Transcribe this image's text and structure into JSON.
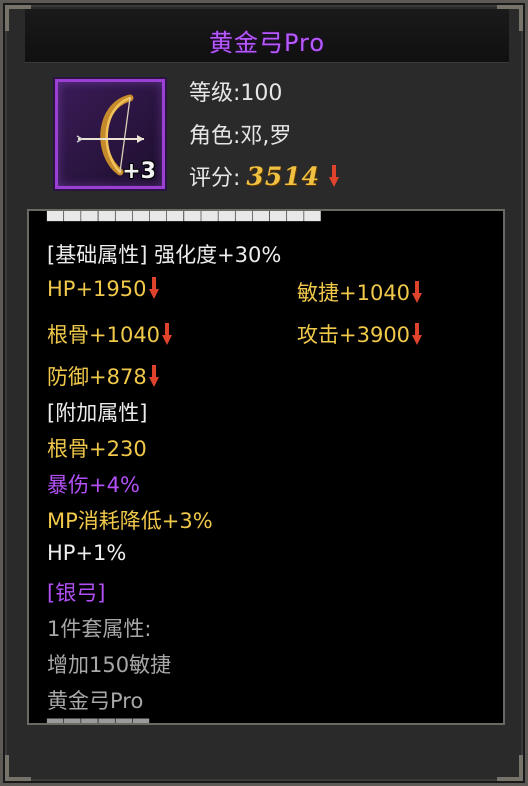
{
  "item": {
    "name": "黄金弓Pro",
    "enhance_label": "+3",
    "icon": "bow-icon"
  },
  "info": {
    "level_label": "等级:",
    "level_value": "100",
    "role_label": "角色:",
    "role_value": "邓,罗",
    "score_label": "评分:",
    "score_value": "3514"
  },
  "stats": {
    "base_header": "[基础属性]",
    "strengthen": "强化度+30%",
    "base": [
      {
        "text": "HP+1950",
        "down": true
      },
      {
        "text": "敏捷+1040",
        "down": true
      },
      {
        "text": "根骨+1040",
        "down": true
      },
      {
        "text": "攻击+3900",
        "down": true
      },
      {
        "text": "防御+878",
        "down": true
      }
    ],
    "extra_header": "[附加属性]",
    "extra": [
      {
        "text": "根骨+230"
      },
      {
        "text": "暴伤+4%"
      },
      {
        "text": "MP消耗降低+3%"
      },
      {
        "text": "HP+1%"
      }
    ],
    "set_header": "[银弓]",
    "set_bonus_label": "1件套属性:",
    "set_bonus_effect": "增加150敏捷",
    "set_item": "黄金弓Pro"
  },
  "colors": {
    "title": "#b659ff",
    "gold": "#f0c84a",
    "purple": "#b24ff5",
    "down_arrow": "#e0432b",
    "score": "#f0c040"
  }
}
